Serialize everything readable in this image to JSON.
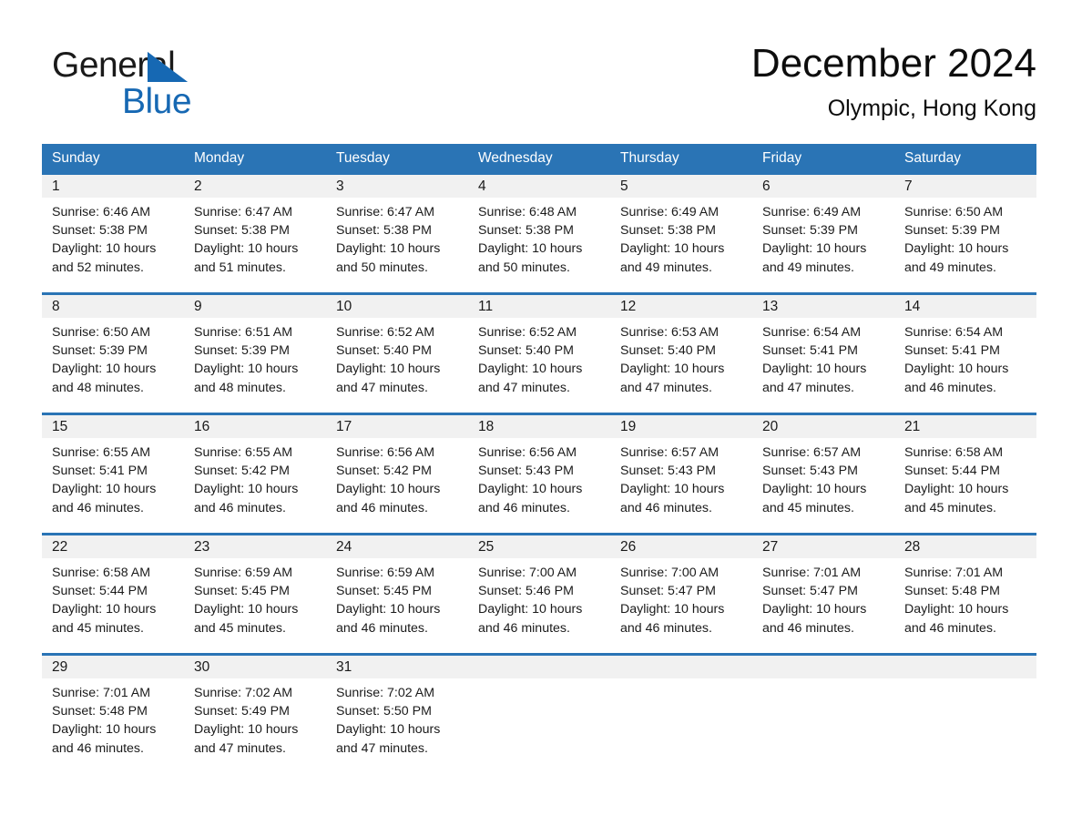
{
  "brand": {
    "name_part1": "General",
    "name_part2": "Blue",
    "triangle_color": "#1668b3",
    "text_color": "#1a1a1a"
  },
  "header": {
    "title": "December 2024",
    "subtitle": "Olympic, Hong Kong"
  },
  "theme": {
    "header_blue": "#2a74b5",
    "row_band_gray": "#f1f1f1",
    "page_background": "#ffffff",
    "text": "#1a1a1a"
  },
  "weekdays": [
    "Sunday",
    "Monday",
    "Tuesday",
    "Wednesday",
    "Thursday",
    "Friday",
    "Saturday"
  ],
  "weeks": [
    [
      {
        "day": "1",
        "sunrise": "Sunrise: 6:46 AM",
        "sunset": "Sunset: 5:38 PM",
        "daylight": "Daylight: 10 hours and 52 minutes."
      },
      {
        "day": "2",
        "sunrise": "Sunrise: 6:47 AM",
        "sunset": "Sunset: 5:38 PM",
        "daylight": "Daylight: 10 hours and 51 minutes."
      },
      {
        "day": "3",
        "sunrise": "Sunrise: 6:47 AM",
        "sunset": "Sunset: 5:38 PM",
        "daylight": "Daylight: 10 hours and 50 minutes."
      },
      {
        "day": "4",
        "sunrise": "Sunrise: 6:48 AM",
        "sunset": "Sunset: 5:38 PM",
        "daylight": "Daylight: 10 hours and 50 minutes."
      },
      {
        "day": "5",
        "sunrise": "Sunrise: 6:49 AM",
        "sunset": "Sunset: 5:38 PM",
        "daylight": "Daylight: 10 hours and 49 minutes."
      },
      {
        "day": "6",
        "sunrise": "Sunrise: 6:49 AM",
        "sunset": "Sunset: 5:39 PM",
        "daylight": "Daylight: 10 hours and 49 minutes."
      },
      {
        "day": "7",
        "sunrise": "Sunrise: 6:50 AM",
        "sunset": "Sunset: 5:39 PM",
        "daylight": "Daylight: 10 hours and 49 minutes."
      }
    ],
    [
      {
        "day": "8",
        "sunrise": "Sunrise: 6:50 AM",
        "sunset": "Sunset: 5:39 PM",
        "daylight": "Daylight: 10 hours and 48 minutes."
      },
      {
        "day": "9",
        "sunrise": "Sunrise: 6:51 AM",
        "sunset": "Sunset: 5:39 PM",
        "daylight": "Daylight: 10 hours and 48 minutes."
      },
      {
        "day": "10",
        "sunrise": "Sunrise: 6:52 AM",
        "sunset": "Sunset: 5:40 PM",
        "daylight": "Daylight: 10 hours and 47 minutes."
      },
      {
        "day": "11",
        "sunrise": "Sunrise: 6:52 AM",
        "sunset": "Sunset: 5:40 PM",
        "daylight": "Daylight: 10 hours and 47 minutes."
      },
      {
        "day": "12",
        "sunrise": "Sunrise: 6:53 AM",
        "sunset": "Sunset: 5:40 PM",
        "daylight": "Daylight: 10 hours and 47 minutes."
      },
      {
        "day": "13",
        "sunrise": "Sunrise: 6:54 AM",
        "sunset": "Sunset: 5:41 PM",
        "daylight": "Daylight: 10 hours and 47 minutes."
      },
      {
        "day": "14",
        "sunrise": "Sunrise: 6:54 AM",
        "sunset": "Sunset: 5:41 PM",
        "daylight": "Daylight: 10 hours and 46 minutes."
      }
    ],
    [
      {
        "day": "15",
        "sunrise": "Sunrise: 6:55 AM",
        "sunset": "Sunset: 5:41 PM",
        "daylight": "Daylight: 10 hours and 46 minutes."
      },
      {
        "day": "16",
        "sunrise": "Sunrise: 6:55 AM",
        "sunset": "Sunset: 5:42 PM",
        "daylight": "Daylight: 10 hours and 46 minutes."
      },
      {
        "day": "17",
        "sunrise": "Sunrise: 6:56 AM",
        "sunset": "Sunset: 5:42 PM",
        "daylight": "Daylight: 10 hours and 46 minutes."
      },
      {
        "day": "18",
        "sunrise": "Sunrise: 6:56 AM",
        "sunset": "Sunset: 5:43 PM",
        "daylight": "Daylight: 10 hours and 46 minutes."
      },
      {
        "day": "19",
        "sunrise": "Sunrise: 6:57 AM",
        "sunset": "Sunset: 5:43 PM",
        "daylight": "Daylight: 10 hours and 46 minutes."
      },
      {
        "day": "20",
        "sunrise": "Sunrise: 6:57 AM",
        "sunset": "Sunset: 5:43 PM",
        "daylight": "Daylight: 10 hours and 45 minutes."
      },
      {
        "day": "21",
        "sunrise": "Sunrise: 6:58 AM",
        "sunset": "Sunset: 5:44 PM",
        "daylight": "Daylight: 10 hours and 45 minutes."
      }
    ],
    [
      {
        "day": "22",
        "sunrise": "Sunrise: 6:58 AM",
        "sunset": "Sunset: 5:44 PM",
        "daylight": "Daylight: 10 hours and 45 minutes."
      },
      {
        "day": "23",
        "sunrise": "Sunrise: 6:59 AM",
        "sunset": "Sunset: 5:45 PM",
        "daylight": "Daylight: 10 hours and 45 minutes."
      },
      {
        "day": "24",
        "sunrise": "Sunrise: 6:59 AM",
        "sunset": "Sunset: 5:45 PM",
        "daylight": "Daylight: 10 hours and 46 minutes."
      },
      {
        "day": "25",
        "sunrise": "Sunrise: 7:00 AM",
        "sunset": "Sunset: 5:46 PM",
        "daylight": "Daylight: 10 hours and 46 minutes."
      },
      {
        "day": "26",
        "sunrise": "Sunrise: 7:00 AM",
        "sunset": "Sunset: 5:47 PM",
        "daylight": "Daylight: 10 hours and 46 minutes."
      },
      {
        "day": "27",
        "sunrise": "Sunrise: 7:01 AM",
        "sunset": "Sunset: 5:47 PM",
        "daylight": "Daylight: 10 hours and 46 minutes."
      },
      {
        "day": "28",
        "sunrise": "Sunrise: 7:01 AM",
        "sunset": "Sunset: 5:48 PM",
        "daylight": "Daylight: 10 hours and 46 minutes."
      }
    ],
    [
      {
        "day": "29",
        "sunrise": "Sunrise: 7:01 AM",
        "sunset": "Sunset: 5:48 PM",
        "daylight": "Daylight: 10 hours and 46 minutes."
      },
      {
        "day": "30",
        "sunrise": "Sunrise: 7:02 AM",
        "sunset": "Sunset: 5:49 PM",
        "daylight": "Daylight: 10 hours and 47 minutes."
      },
      {
        "day": "31",
        "sunrise": "Sunrise: 7:02 AM",
        "sunset": "Sunset: 5:50 PM",
        "daylight": "Daylight: 10 hours and 47 minutes."
      },
      {
        "day": "",
        "sunrise": "",
        "sunset": "",
        "daylight": ""
      },
      {
        "day": "",
        "sunrise": "",
        "sunset": "",
        "daylight": ""
      },
      {
        "day": "",
        "sunrise": "",
        "sunset": "",
        "daylight": ""
      },
      {
        "day": "",
        "sunrise": "",
        "sunset": "",
        "daylight": ""
      }
    ]
  ]
}
